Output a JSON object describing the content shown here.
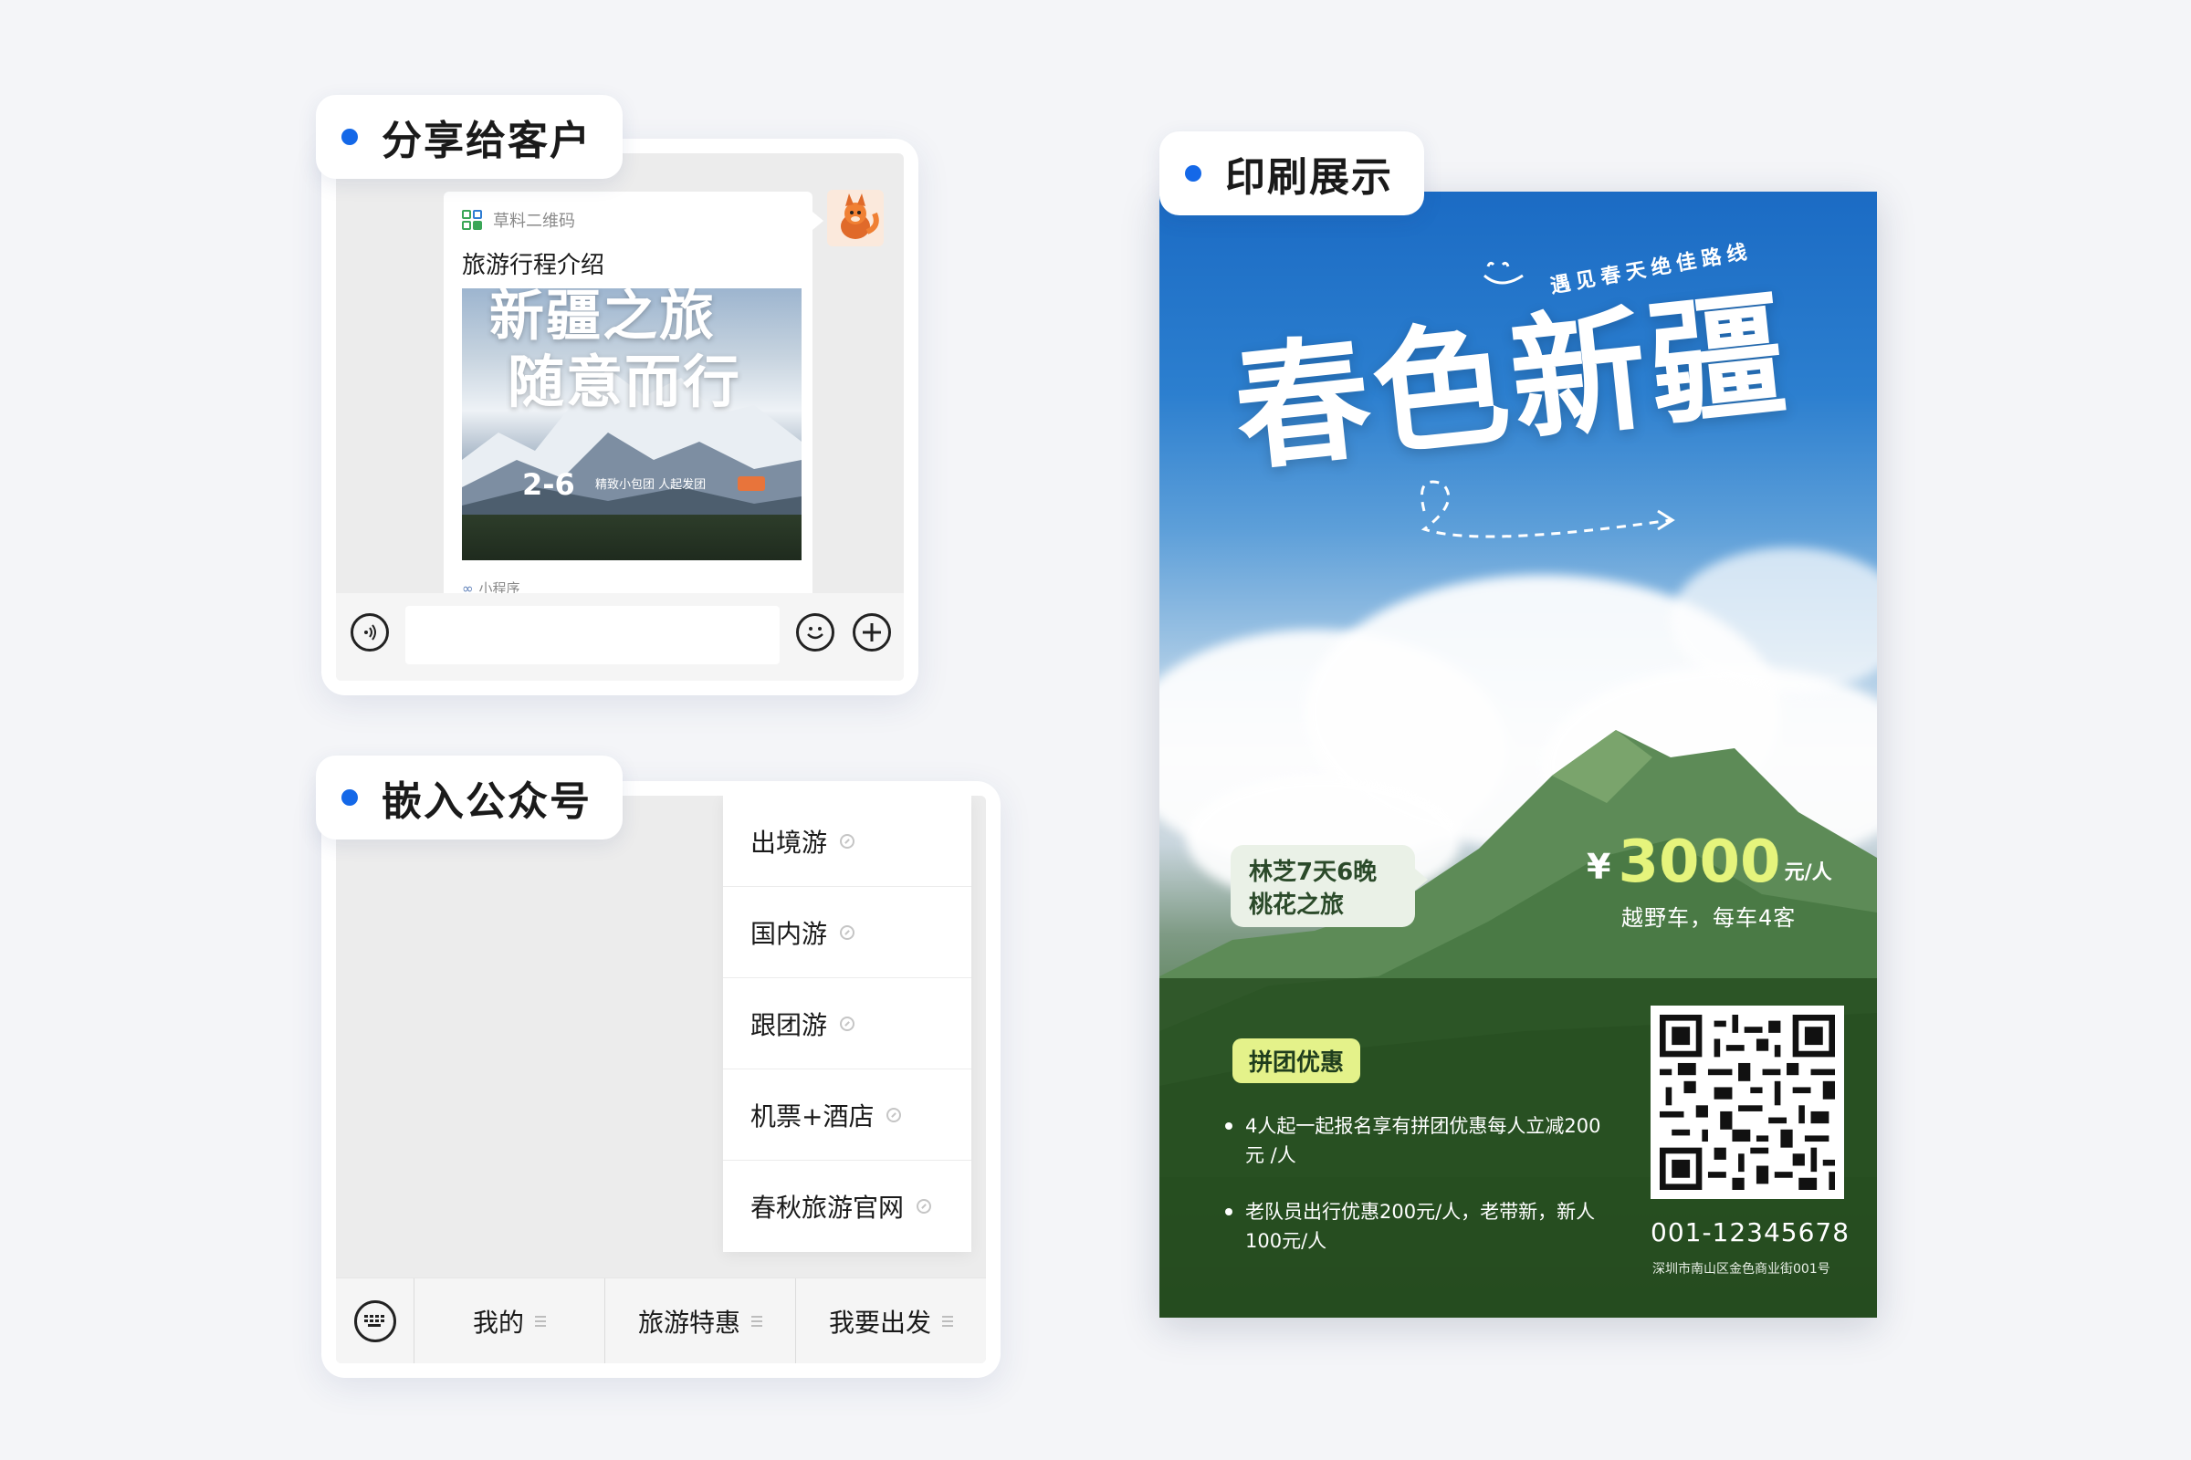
{
  "share_section": {
    "label": "分享给客户",
    "message": {
      "source": "草料二维码",
      "title": "旅游行程介绍",
      "cover_line1": "新疆之旅",
      "cover_line2": "随意而行",
      "cover_date": "2-6",
      "cover_tag": "精致小包团 人起发团",
      "footer": "小程序"
    },
    "toolbar": {
      "voice_icon": "voice-icon",
      "emoji_icon": "emoji-icon",
      "plus_icon": "plus-icon",
      "input_value": ""
    }
  },
  "official_account_section": {
    "label": "嵌入公众号",
    "menu_items": [
      "出境游",
      "国内游",
      "跟团游",
      "机票+酒店",
      "春秋旅游官网"
    ],
    "tabs": [
      "我的",
      "旅游特惠",
      "我要出发"
    ]
  },
  "print_section": {
    "label": "印刷展示",
    "poster": {
      "tagline": "遇见春天绝佳路线",
      "title": "春色新疆",
      "route_line1": "林芝7天6晚",
      "route_line2": "桃花之旅",
      "price_currency": "¥",
      "price_value": "3000",
      "price_unit": "元/人",
      "price_note": "越野车，每车4客",
      "promo_tag": "拼团优惠",
      "promo_items": [
        "4人起一起报名享有拼团优惠每人立减200元 /人",
        "老队员出行优惠200元/人，老带新，新人100元/人"
      ],
      "phone": "001-12345678",
      "address": "深圳市南山区金色商业街001号"
    }
  },
  "colors": {
    "accent": "#1468e8",
    "price_highlight": "#e5f47c",
    "promo_tag_bg": "#e4f28a"
  }
}
